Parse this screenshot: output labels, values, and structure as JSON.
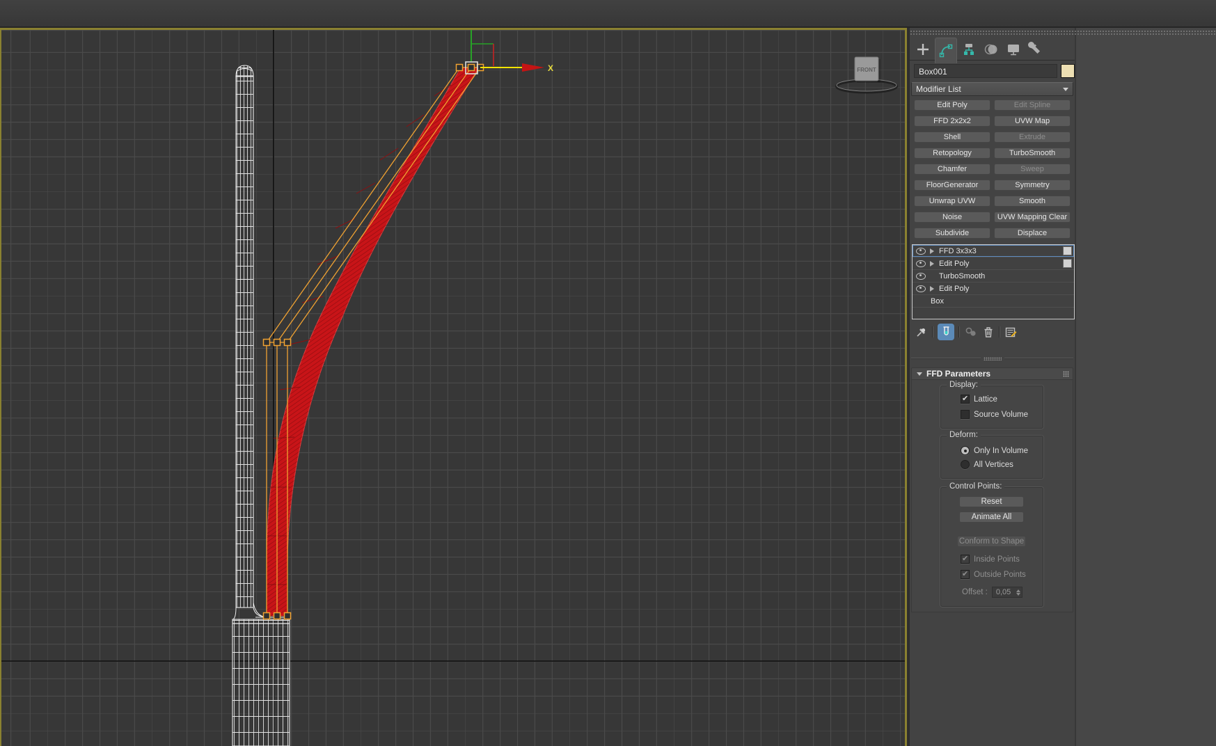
{
  "viewport": {
    "viewcube_label": "FRONT",
    "axis_x_label": "X"
  },
  "panel": {
    "object_name": "Box001",
    "modifier_list_label": "Modifier List",
    "buttons": [
      {
        "label": "Edit Poly",
        "enabled": true
      },
      {
        "label": "Edit Spline",
        "enabled": false
      },
      {
        "label": "FFD 2x2x2",
        "enabled": true
      },
      {
        "label": "UVW Map",
        "enabled": true
      },
      {
        "label": "Shell",
        "enabled": true
      },
      {
        "label": "Extrude",
        "enabled": false
      },
      {
        "label": "Retopology",
        "enabled": true
      },
      {
        "label": "TurboSmooth",
        "enabled": true
      },
      {
        "label": "Chamfer",
        "enabled": true
      },
      {
        "label": "Sweep",
        "enabled": false
      },
      {
        "label": "FloorGenerator",
        "enabled": true
      },
      {
        "label": "Symmetry",
        "enabled": true
      },
      {
        "label": "Unwrap UVW",
        "enabled": true
      },
      {
        "label": "Smooth",
        "enabled": true
      },
      {
        "label": "Noise",
        "enabled": true
      },
      {
        "label": "UVW Mapping Clear",
        "enabled": true
      },
      {
        "label": "Subdivide",
        "enabled": true
      },
      {
        "label": "Displace",
        "enabled": true
      }
    ],
    "stack": [
      {
        "label": "FFD 3x3x3",
        "selected": true,
        "eye": true,
        "expandable": true
      },
      {
        "label": "Edit Poly",
        "selected": false,
        "eye": true,
        "expandable": true
      },
      {
        "label": "TurboSmooth",
        "selected": false,
        "eye": true,
        "expandable": false
      },
      {
        "label": "Edit Poly",
        "selected": false,
        "eye": true,
        "expandable": true
      },
      {
        "label": "Box",
        "selected": false,
        "eye": false,
        "expandable": false
      }
    ],
    "rollout": {
      "title": "FFD Parameters",
      "display_label": "Display:",
      "lattice": "Lattice",
      "lattice_checked": true,
      "source_volume": "Source Volume",
      "source_volume_checked": false,
      "deform_label": "Deform:",
      "only_in_volume": "Only In Volume",
      "only_in_volume_selected": true,
      "all_vertices": "All Vertices",
      "control_points_label": "Control Points:",
      "reset": "Reset",
      "animate_all": "Animate All",
      "conform_to_shape": "Conform to Shape",
      "inside_points": "Inside Points",
      "inside_points_checked": true,
      "outside_points": "Outside Points",
      "outside_points_checked": true,
      "offset_label": "Offset :",
      "offset_value": "0,05"
    }
  },
  "icons": {
    "create-icon": "plus",
    "modify-icon": "teal bezier curve with handles",
    "hierarchy-icon": "node tree",
    "motion-icon": "overlapping circles",
    "display-icon": "monitor",
    "utilities-icon": "wrench",
    "pin-stack-icon": "pushpin",
    "show-end-result-icon": "test tube (active)",
    "make-unique-icon": "linked circles (disabled)",
    "remove-modifier-icon": "trash bin",
    "configure-modifier-sets-icon": "list with pencil",
    "eye-icon": "visibility eye",
    "expand-arrow-icon": "right triangle"
  },
  "colors": {
    "viewport_bg": "#373737",
    "grid_line": "#4b4b4b",
    "viewport_border": "#8a8130",
    "panel_bg": "#454545",
    "accent_teal": "#35b8aa",
    "selection_blue": "#5f8cc0",
    "lattice_orange": "#f0a232",
    "arm_red": "#c81418",
    "gizmo_yellow": "#f2e400",
    "gizmo_green": "#27a327",
    "gizmo_red": "#c42222",
    "object_color_swatch": "#eddfb3"
  }
}
